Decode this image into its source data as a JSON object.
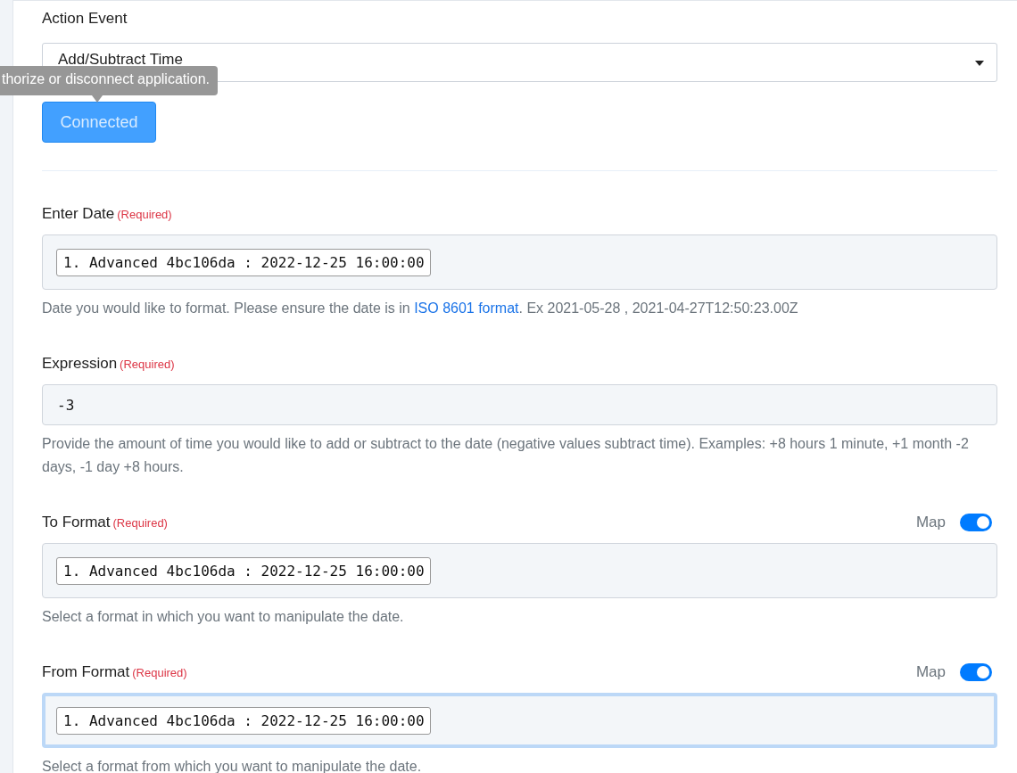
{
  "action_event": {
    "label": "Action Event",
    "value": "Add/Subtract Time"
  },
  "tooltip": {
    "text": "thorize or disconnect application."
  },
  "connect_button": {
    "label": "Connected"
  },
  "fields": [
    {
      "label": "Enter Date",
      "required": "(Required)",
      "kind": "tag",
      "value": "1. Advanced 4bc106da : 2022-12-25 16:00:00",
      "focused": false,
      "help": {
        "before": "Date you would like to format. Please ensure the date is in ",
        "link": "ISO 8601 format",
        "after": ". Ex 2021-05-28 , 2021-04-27T12:50:23.00Z"
      }
    },
    {
      "label": "Expression",
      "required": "(Required)",
      "kind": "text",
      "value": "-3",
      "focused": false,
      "help": {
        "before": "Provide the amount of time you would like to add or subtract to the date (negative values subtract time). Examples: +8 hours 1 minute, +1 month -2 days, -1 day +8 hours."
      }
    },
    {
      "label": "To Format",
      "required": "(Required)",
      "kind": "tag",
      "value": "1. Advanced 4bc106da : 2022-12-25 16:00:00",
      "focused": false,
      "map": {
        "label": "Map",
        "on": true
      },
      "help": {
        "before": "Select a format in which you want to manipulate the date."
      }
    },
    {
      "label": "From Format",
      "required": "(Required)",
      "kind": "tag",
      "value": "1. Advanced 4bc106da : 2022-12-25 16:00:00",
      "focused": true,
      "map": {
        "label": "Map",
        "on": true
      },
      "help": {
        "before": "Select a format from which you want to manipulate the date."
      }
    }
  ]
}
